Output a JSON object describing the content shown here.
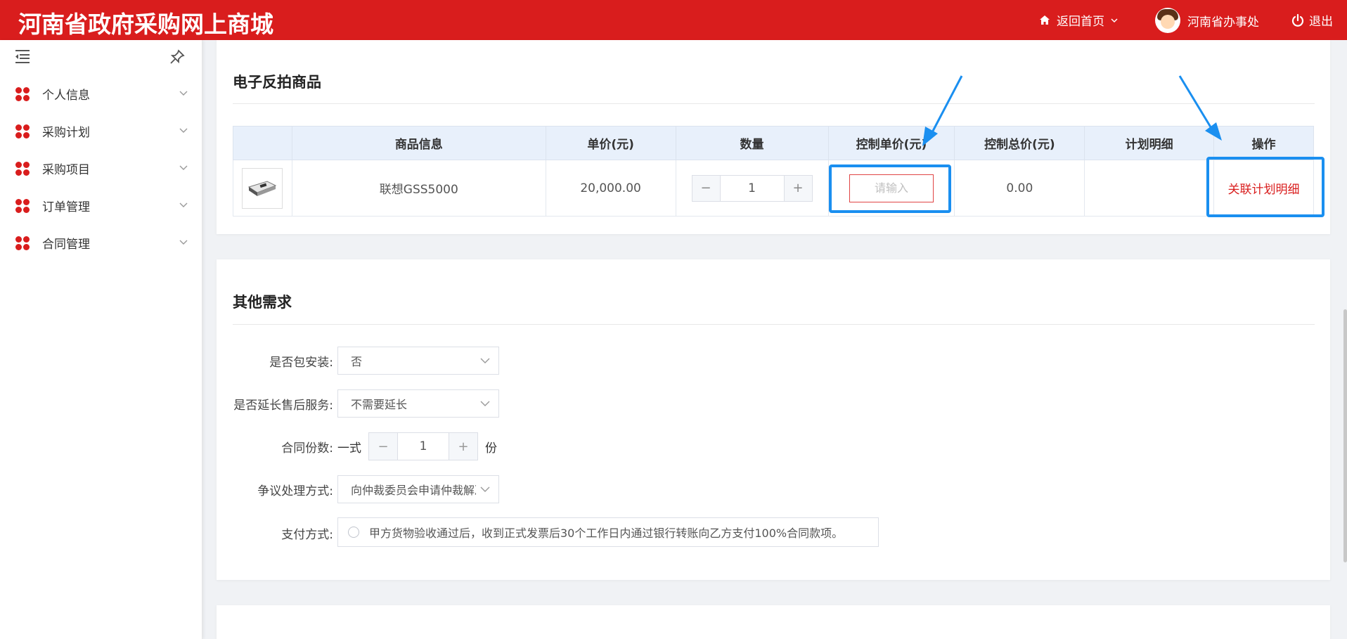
{
  "header": {
    "brand": "河南省政府采购网上商城",
    "home_link": "返回首页",
    "user_name": "河南省办事处",
    "logout": "退出",
    "colors": {
      "brand_red": "#d91d1d",
      "annotation_blue": "#1a8ff0"
    }
  },
  "sidebar": {
    "items": [
      {
        "label": "个人信息"
      },
      {
        "label": "采购计划"
      },
      {
        "label": "采购项目"
      },
      {
        "label": "订单管理"
      },
      {
        "label": "合同管理"
      }
    ]
  },
  "goods_section": {
    "title": "电子反拍商品",
    "columns": [
      "商品信息",
      "单价(元)",
      "数量",
      "控制单价(元)",
      "控制总价(元)",
      "计划明细",
      "操作"
    ],
    "rows": [
      {
        "name": "联想GSS5000",
        "unit_price": "20,000.00",
        "quantity": "1",
        "control_price_placeholder": "请输入",
        "control_total": "0.00",
        "plan_detail": "",
        "action": "关联计划明细"
      }
    ]
  },
  "other_section": {
    "title": "其他需求",
    "install_label": "是否包安装:",
    "install_value": "否",
    "extend_label": "是否延长售后服务:",
    "extend_value": "不需要延长",
    "copies_label": "合同份数:",
    "copies_prefix": "一式",
    "copies_value": "1",
    "copies_suffix": "份",
    "dispute_label": "争议处理方式:",
    "dispute_value": "向仲裁委员会申请仲裁解决",
    "payment_label": "支付方式:",
    "payment_option": "甲方货物验收通过后，收到正式发票后30个工作日内通过银行转账向乙方支付100%合同款项。"
  }
}
